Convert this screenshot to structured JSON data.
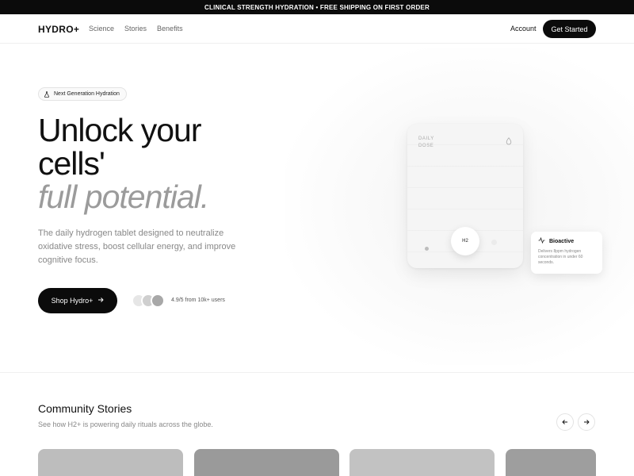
{
  "announcement": "CLINICAL STRENGTH HYDRATION • FREE SHIPPING ON FIRST ORDER",
  "nav": {
    "logo": "HYDRO+",
    "links": [
      "Science",
      "Stories",
      "Benefits"
    ],
    "account": "Account",
    "cta": "Get Started"
  },
  "hero": {
    "badge": "Next Generation Hydration",
    "headline_line1": "Unlock your",
    "headline_line2": "cells'",
    "headline_line3": "full potential.",
    "subtitle": "The daily hydrogen tablet designed to neutralize oxidative stress, boost cellular energy, and improve cognitive focus.",
    "shop_button": "Shop Hydro+",
    "rating": "4.9/5 from 10k+ users"
  },
  "product_card": {
    "label": "DAILY\nDOSE",
    "center": "H2"
  },
  "bioactive": {
    "title": "Bioactive",
    "text": "Delivers 8ppm hydrogen concentration in under 60 seconds."
  },
  "community": {
    "title": "Community Stories",
    "subtitle": "See how H2+ is powering daily rituals across the globe."
  },
  "colors": {
    "dark": "#0b0b0b",
    "muted_text": "#888888",
    "accent_gray": "#9b9b9b",
    "avatar_1": "#e6e6e6",
    "avatar_2": "#cfcfcf",
    "avatar_3": "#a8a8a8",
    "story_1": "#bdbdbd",
    "story_2": "#9a9a9a",
    "story_3": "#c2c2c2",
    "story_4": "#9e9e9e"
  }
}
